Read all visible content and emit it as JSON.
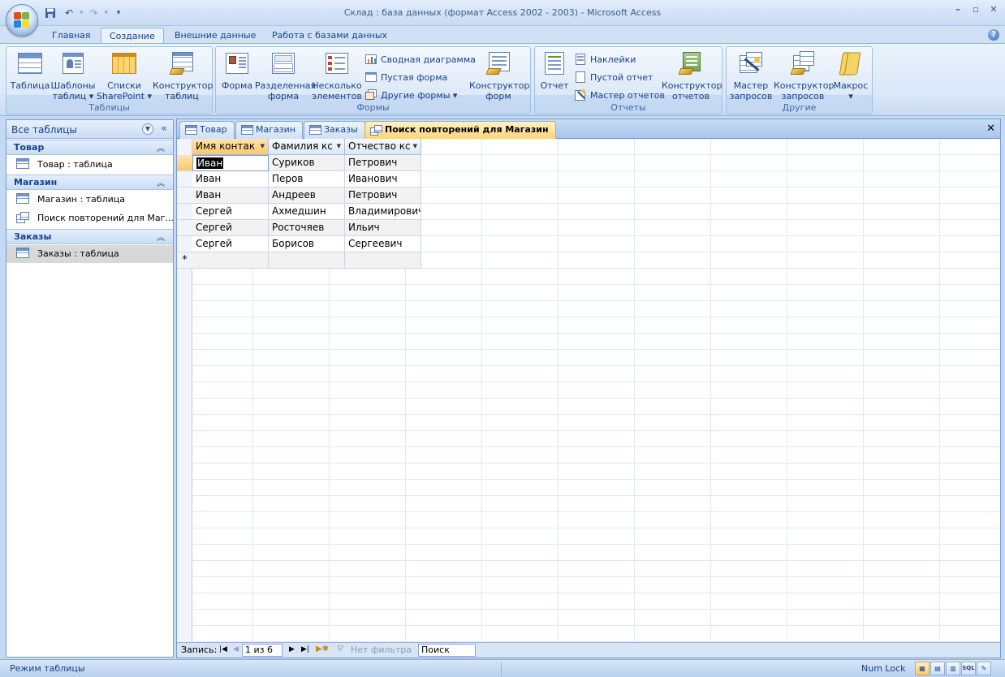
{
  "window": {
    "title": "Склад : база данных (формат Access 2002 - 2003) - Microsoft Access"
  },
  "ribbon_tabs": [
    {
      "label": "Главная"
    },
    {
      "label": "Создание"
    },
    {
      "label": "Внешние данные"
    },
    {
      "label": "Работа с базами данных"
    }
  ],
  "groups": {
    "tables": {
      "label": "Таблицы",
      "buttons": [
        {
          "line1": "Таблица",
          "line2": ""
        },
        {
          "line1": "Шаблоны",
          "line2": "таблиц ▾"
        },
        {
          "line1": "Списки",
          "line2": "SharePoint ▾"
        },
        {
          "line1": "Конструктор",
          "line2": "таблиц"
        }
      ]
    },
    "forms": {
      "label": "Формы",
      "buttons": [
        {
          "line1": "Форма",
          "line2": ""
        },
        {
          "line1": "Разделенная",
          "line2": "форма"
        },
        {
          "line1": "Несколько",
          "line2": "элементов"
        },
        {
          "line1": "Конструктор",
          "line2": "форм"
        }
      ],
      "small": [
        "Сводная диаграмма",
        "Пустая форма",
        "Другие формы ▾"
      ]
    },
    "reports": {
      "label": "Отчеты",
      "buttons": [
        {
          "line1": "Отчет",
          "line2": ""
        },
        {
          "line1": "Конструктор",
          "line2": "отчетов"
        }
      ],
      "small": [
        "Наклейки",
        "Пустой отчет",
        "Мастер отчетов"
      ]
    },
    "other": {
      "label": "Другие",
      "buttons": [
        {
          "line1": "Мастер",
          "line2": "запросов"
        },
        {
          "line1": "Конструктор",
          "line2": "запросов"
        },
        {
          "line1": "Макрос",
          "line2": "▾"
        }
      ]
    }
  },
  "nav": {
    "title": "Все таблицы",
    "categories": [
      {
        "name": "Товар",
        "items": [
          "Товар : таблица"
        ]
      },
      {
        "name": "Магазин",
        "items": [
          "Магазин : таблица",
          "Поиск повторений для Маг..."
        ]
      },
      {
        "name": "Заказы",
        "items": [
          "Заказы : таблица"
        ]
      }
    ]
  },
  "doc_tabs": [
    {
      "label": "Товар"
    },
    {
      "label": "Магазин"
    },
    {
      "label": "Заказы"
    },
    {
      "label": "Поиск повторений для Магазин"
    }
  ],
  "datasheet": {
    "columns": [
      "Имя контак",
      "Фамилия кс",
      "Отчество кс"
    ],
    "rows": [
      [
        "Иван",
        "Суриков",
        "Петрович"
      ],
      [
        "Иван",
        "Перов",
        "Иванович"
      ],
      [
        "Иван",
        "Андреев",
        "Петрович"
      ],
      [
        "Сергей",
        "Ахмедшин",
        "Владимирович"
      ],
      [
        "Сергей",
        "Росточяев",
        "Ильич"
      ],
      [
        "Сергей",
        "Борисов",
        "Сергеевич"
      ]
    ],
    "new_row_marker": "*"
  },
  "record_nav": {
    "label": "Запись:",
    "current": "1 из 6",
    "filter": "Нет фильтра",
    "search_placeholder": "Поиск"
  },
  "status": {
    "mode": "Режим таблицы",
    "numlock": "Num Lock",
    "sql": "SQL"
  }
}
